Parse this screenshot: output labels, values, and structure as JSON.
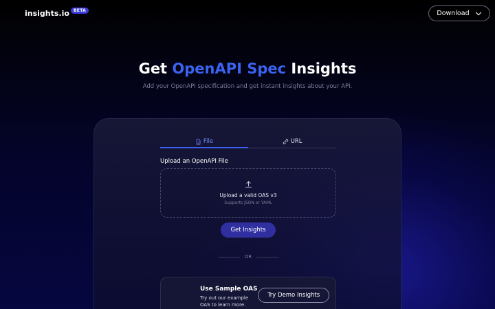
{
  "header": {
    "logo_text": "insights.io",
    "beta_badge": "BETA",
    "download_label": "Download"
  },
  "hero": {
    "title_prefix": "Get ",
    "title_accent": "OpenAPI Spec",
    "title_suffix": " Insights",
    "subtitle": "Add your OpenAPI specification and get instant insights about your API."
  },
  "card": {
    "tabs": [
      {
        "label": "File",
        "icon": "file-icon",
        "active": true
      },
      {
        "label": "URL",
        "icon": "link-icon",
        "active": false
      }
    ],
    "field_label": "Upload an OpenAPI File",
    "dropzone": {
      "icon": "upload-icon",
      "main_text": "Upload a valid OAS v3",
      "sub_text": "Supports JSON or YAML"
    },
    "submit_label": "Get Insights",
    "or_label": "OR",
    "sample": {
      "title": "Use Sample OAS",
      "description": "Try out our example OAS to learn more.",
      "button_label": "Try Demo Insights"
    }
  },
  "colors": {
    "accent": "#3b63f0",
    "primary_button": "#2f2fa0",
    "beta_badge": "#3b3dd6",
    "background": "#05052e"
  }
}
